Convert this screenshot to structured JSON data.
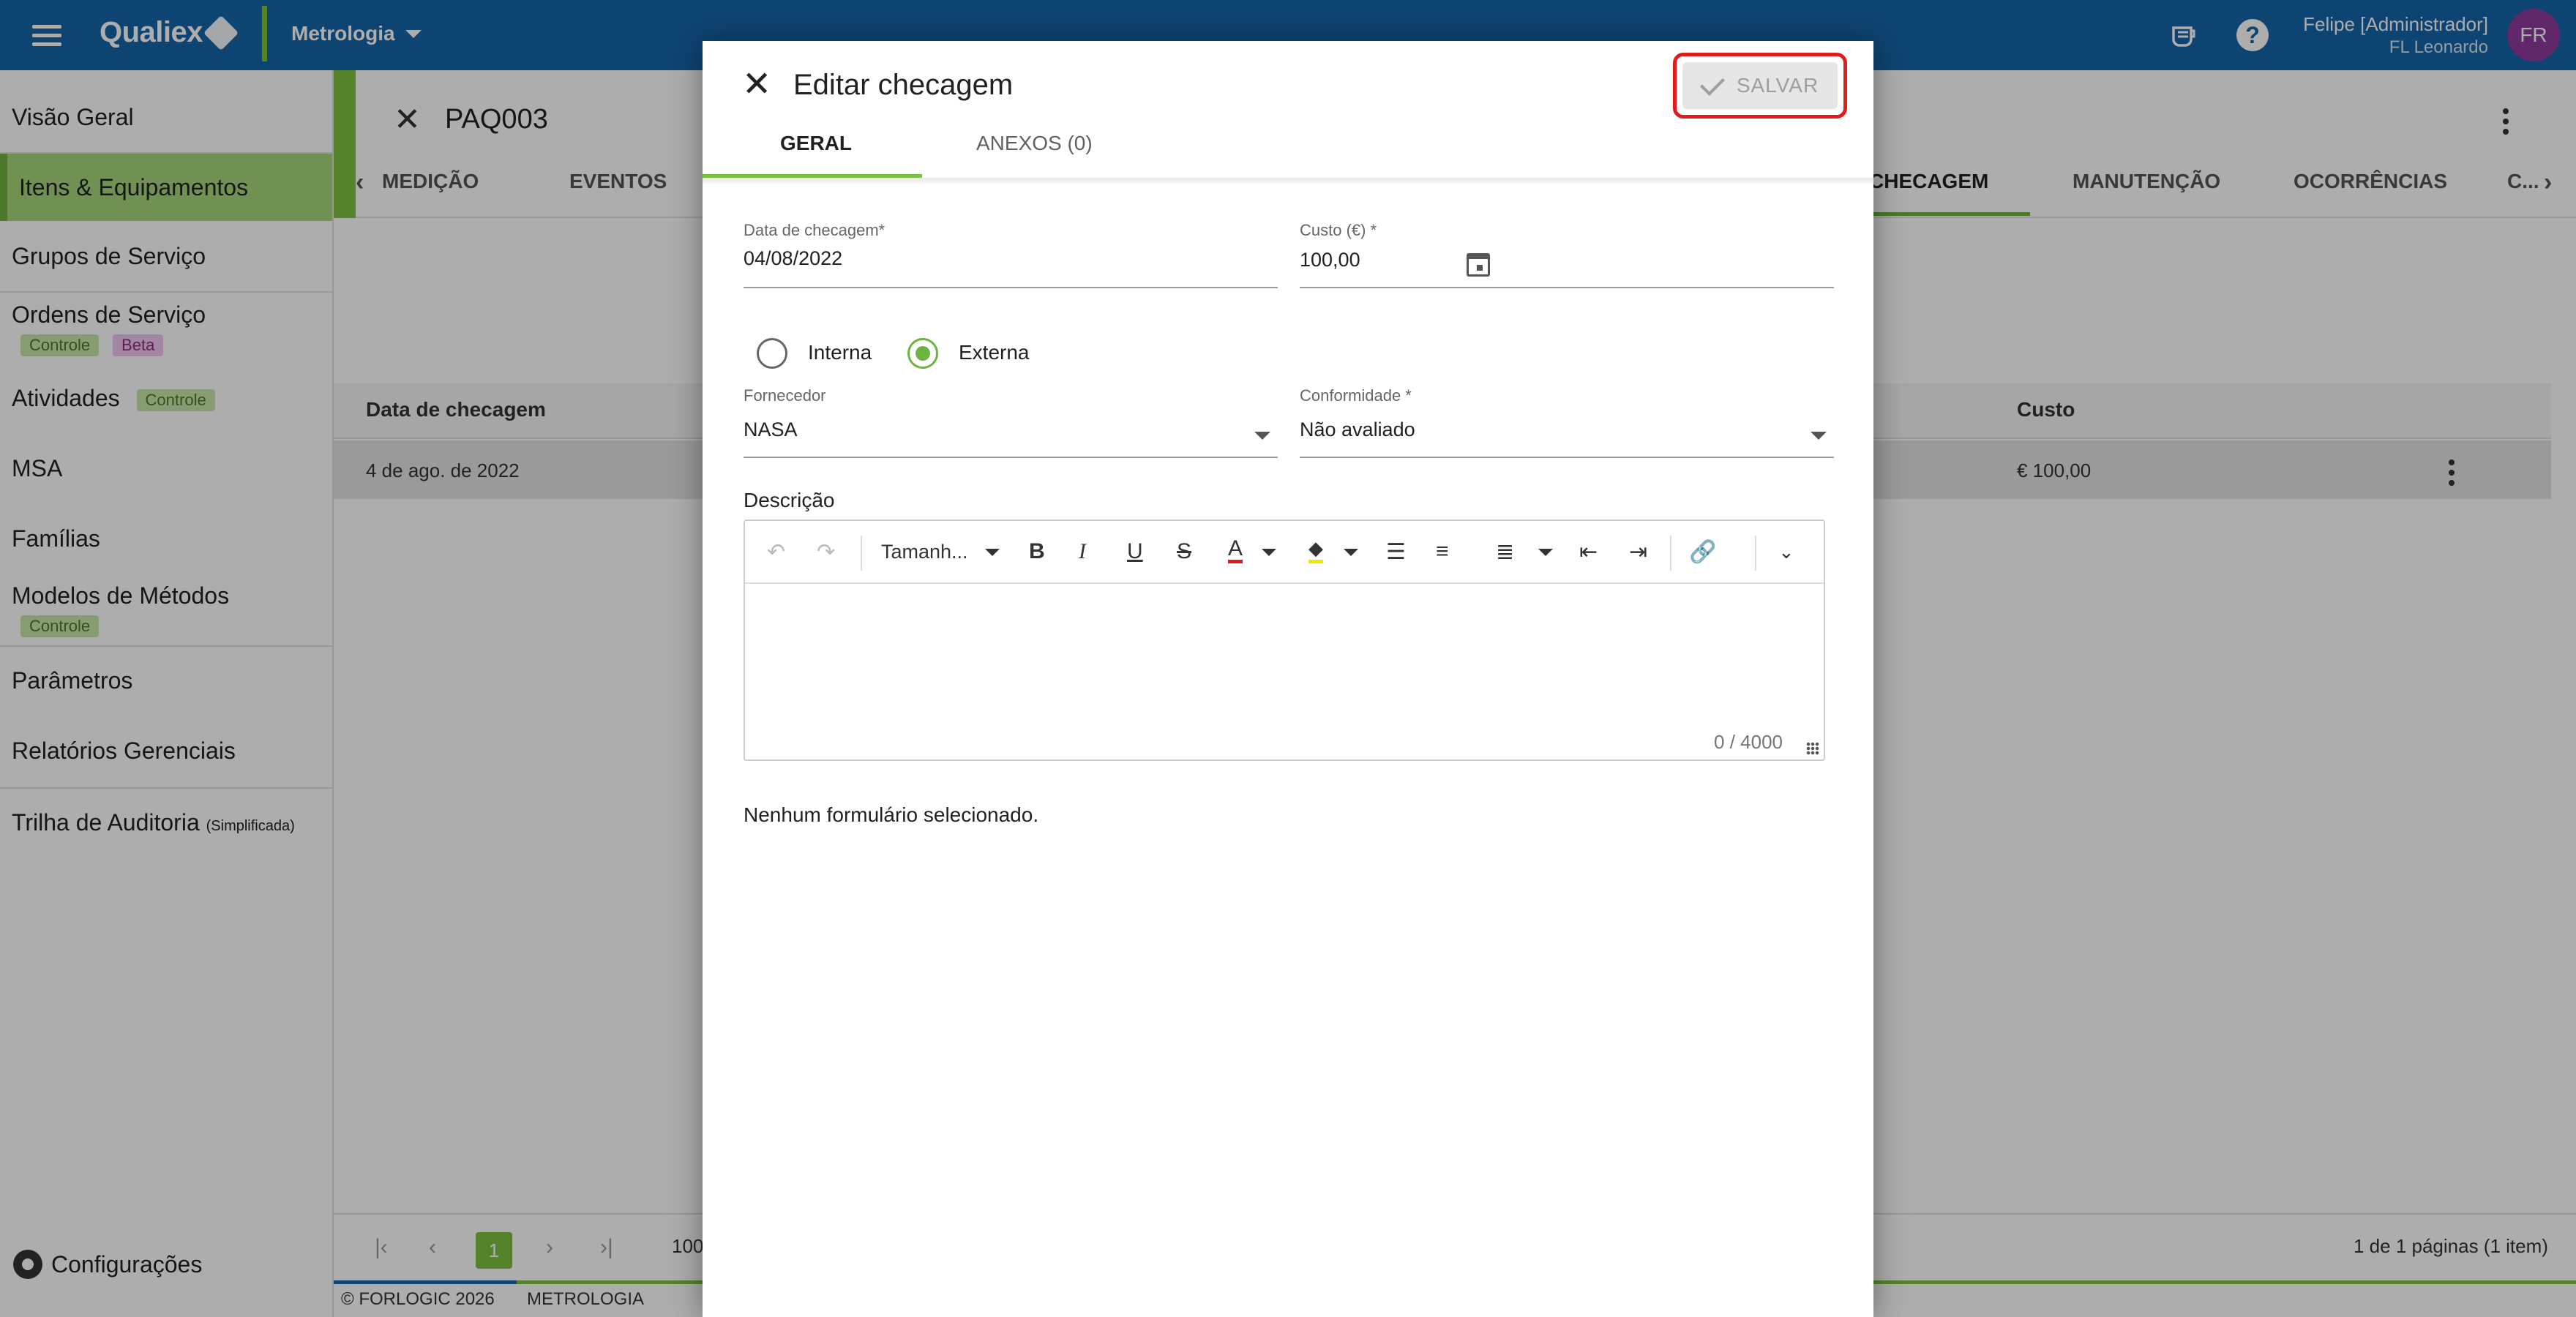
{
  "topbar": {
    "app_name": "Qualiex",
    "module": "Metrologia",
    "user_name": "Felipe [Administrador]",
    "user_company": "FL Leonardo",
    "avatar_initials": "FR",
    "help_glyph": "?",
    "bg_color": "#1565a8",
    "accent_color": "#7cc242"
  },
  "sidebar": {
    "items": [
      {
        "label": "Visão Geral"
      },
      {
        "label": "Itens & Equipamentos"
      },
      {
        "label": "Grupos de Serviço"
      },
      {
        "label": "Ordens de Serviço",
        "tags": [
          "Controle",
          "Beta"
        ]
      },
      {
        "label": "Atividades",
        "tags": [
          "Controle"
        ]
      },
      {
        "label": "MSA"
      },
      {
        "label": "Famílias"
      },
      {
        "label": "Modelos de Métodos",
        "tags": [
          "Controle"
        ]
      },
      {
        "label": "Parâmetros"
      },
      {
        "label": "Relatórios Gerenciais"
      },
      {
        "label": "Trilha de Auditoria",
        "suffix": "(Simplificada)"
      }
    ],
    "config_label": "Configurações"
  },
  "main": {
    "doc_title": "PAQ003",
    "tabs": [
      "MEDIÇÃO",
      "EVENTOS",
      "CHECAGEM",
      "MANUTENÇÃO",
      "OCORRÊNCIAS",
      "C..."
    ],
    "grid": {
      "headers": [
        "Data de checagem",
        "Custo"
      ],
      "row": {
        "date": "4 de ago. de 2022",
        "cost": "€ 100,00"
      }
    },
    "pager": {
      "page": "1",
      "page_size": "100",
      "summary": "1 de 1 páginas (1 item)"
    },
    "footer": {
      "copyright": "© FORLOGIC 2026",
      "module": "METROLOGIA"
    }
  },
  "dialog": {
    "title": "Editar checagem",
    "save_label": "SALVAR",
    "tabs": [
      "GERAL",
      "ANEXOS (0)"
    ],
    "fields": {
      "date_label": "Data de checagem*",
      "date_value": "04/08/2022",
      "cost_label": "Custo (€) *",
      "cost_value": "100,00",
      "radio_internal": "Interna",
      "radio_external": "Externa",
      "radio_selected": "Externa",
      "supplier_label": "Fornecedor",
      "supplier_value": "NASA",
      "conformity_label": "Conformidade *",
      "conformity_value": "Não avaliado",
      "description_label": "Descrição",
      "font_size_placeholder": "Tamanh...",
      "char_counter": "0 / 4000"
    },
    "no_form_text": "Nenhum formulário selecionado."
  }
}
